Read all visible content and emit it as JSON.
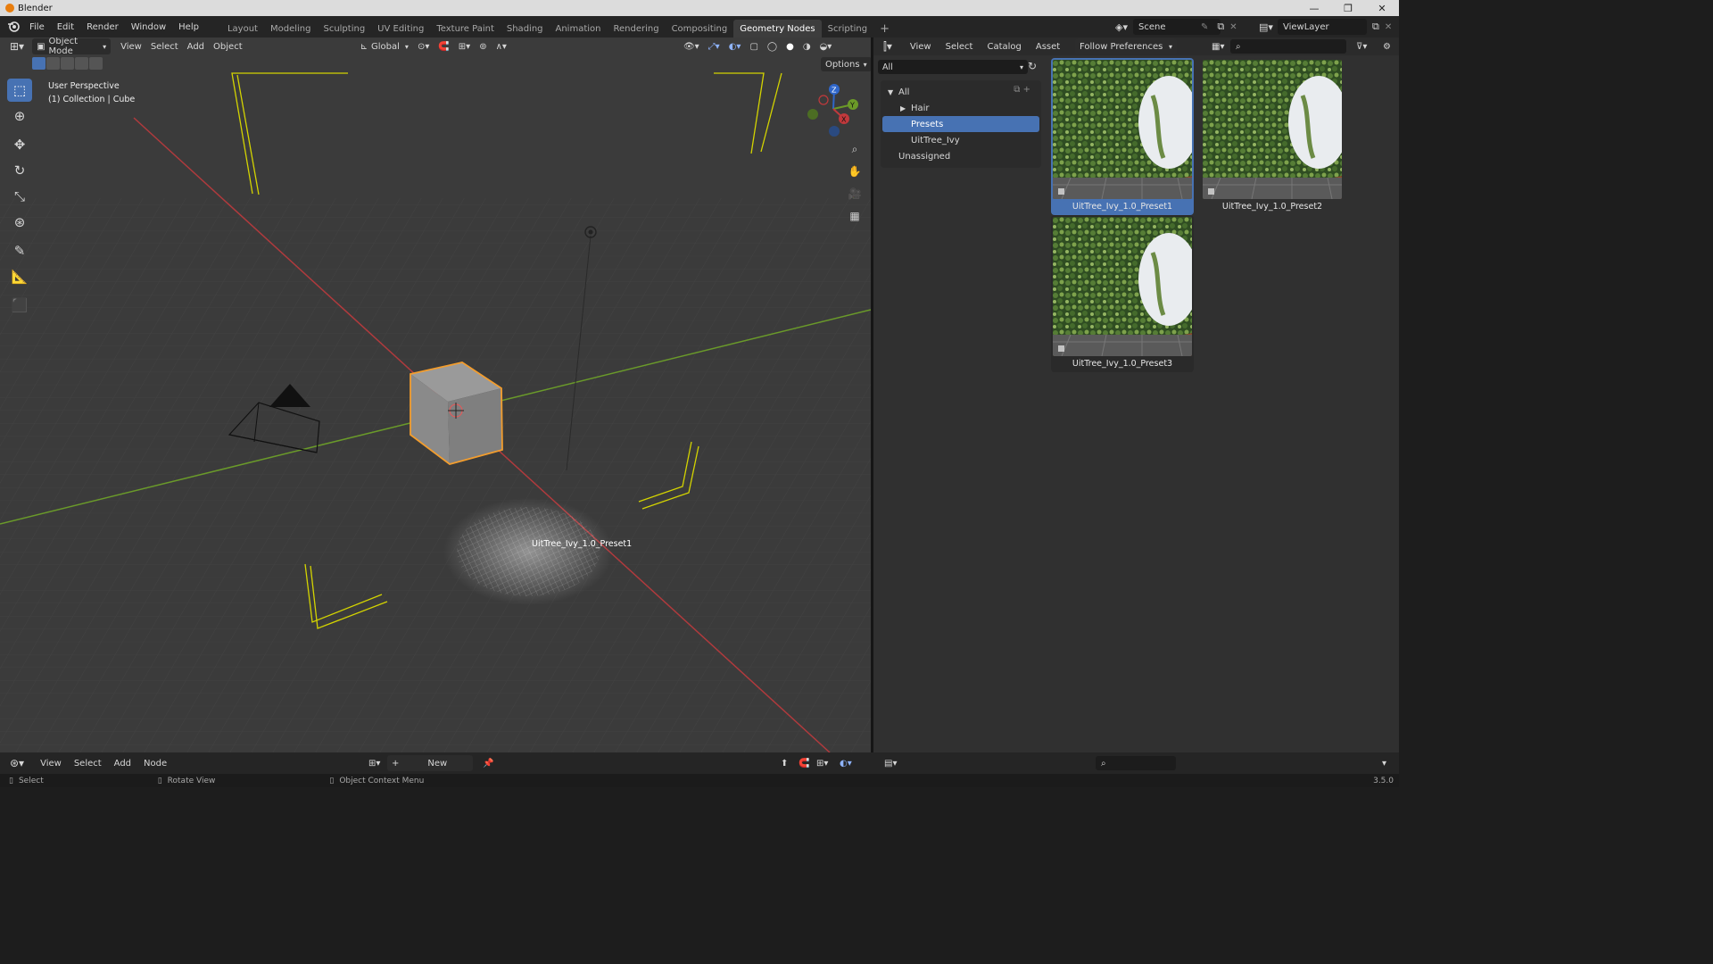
{
  "window": {
    "title": "Blender",
    "controls": [
      "—",
      "❐",
      "✕"
    ]
  },
  "menu": [
    "File",
    "Edit",
    "Render",
    "Window",
    "Help"
  ],
  "workspaces": [
    {
      "label": "Layout",
      "active": false
    },
    {
      "label": "Modeling",
      "active": false
    },
    {
      "label": "Sculpting",
      "active": false
    },
    {
      "label": "UV Editing",
      "active": false
    },
    {
      "label": "Texture Paint",
      "active": false
    },
    {
      "label": "Shading",
      "active": false
    },
    {
      "label": "Animation",
      "active": false
    },
    {
      "label": "Rendering",
      "active": false
    },
    {
      "label": "Compositing",
      "active": false
    },
    {
      "label": "Geometry Nodes",
      "active": true
    },
    {
      "label": "Scripting",
      "active": false
    }
  ],
  "scene": {
    "name": "Scene",
    "view_layer": "ViewLayer"
  },
  "viewport": {
    "mode": "Object Mode",
    "menus": [
      "View",
      "Select",
      "Add",
      "Object"
    ],
    "orientation": "Global",
    "options_label": "Options",
    "info_line1": "User Perspective",
    "info_line2": "(1) Collection | Cube",
    "drop_label": "UitTree_Ivy_1.0_Preset1",
    "gizmo": {
      "z": "Z",
      "y": "Y",
      "x": "X"
    }
  },
  "asset_browser": {
    "menus": [
      "View",
      "Select",
      "Catalog",
      "Asset"
    ],
    "library": "Follow Preferences",
    "filter": "All",
    "catalogs": [
      {
        "label": "All",
        "indent": 0,
        "active": false,
        "arrow": "▼"
      },
      {
        "label": "Hair",
        "indent": 1,
        "active": false,
        "arrow": "▶"
      },
      {
        "label": "Presets",
        "indent": 1,
        "active": true,
        "arrow": ""
      },
      {
        "label": "UitTree_Ivy",
        "indent": 1,
        "active": false,
        "arrow": ""
      },
      {
        "label": "Unassigned",
        "indent": 0,
        "active": false,
        "arrow": ""
      }
    ],
    "assets": [
      {
        "name": "UitTree_Ivy_1.0_Preset1",
        "selected": true
      },
      {
        "name": "UitTree_Ivy_1.0_Preset2",
        "selected": false
      },
      {
        "name": "UitTree_Ivy_1.0_Preset3",
        "selected": false
      }
    ]
  },
  "node_editor": {
    "menus": [
      "View",
      "Select",
      "Add",
      "Node"
    ],
    "new_label": "New"
  },
  "status": {
    "select": "Select",
    "rotate": "Rotate View",
    "context": "Object Context Menu",
    "version": "3.5.0"
  },
  "colors": {
    "accent": "#4772b3",
    "selection_outline": "#f29d2e",
    "x_axis": "#c0393c",
    "y_axis": "#6d9a27",
    "ivy": "#3c5e2a"
  }
}
